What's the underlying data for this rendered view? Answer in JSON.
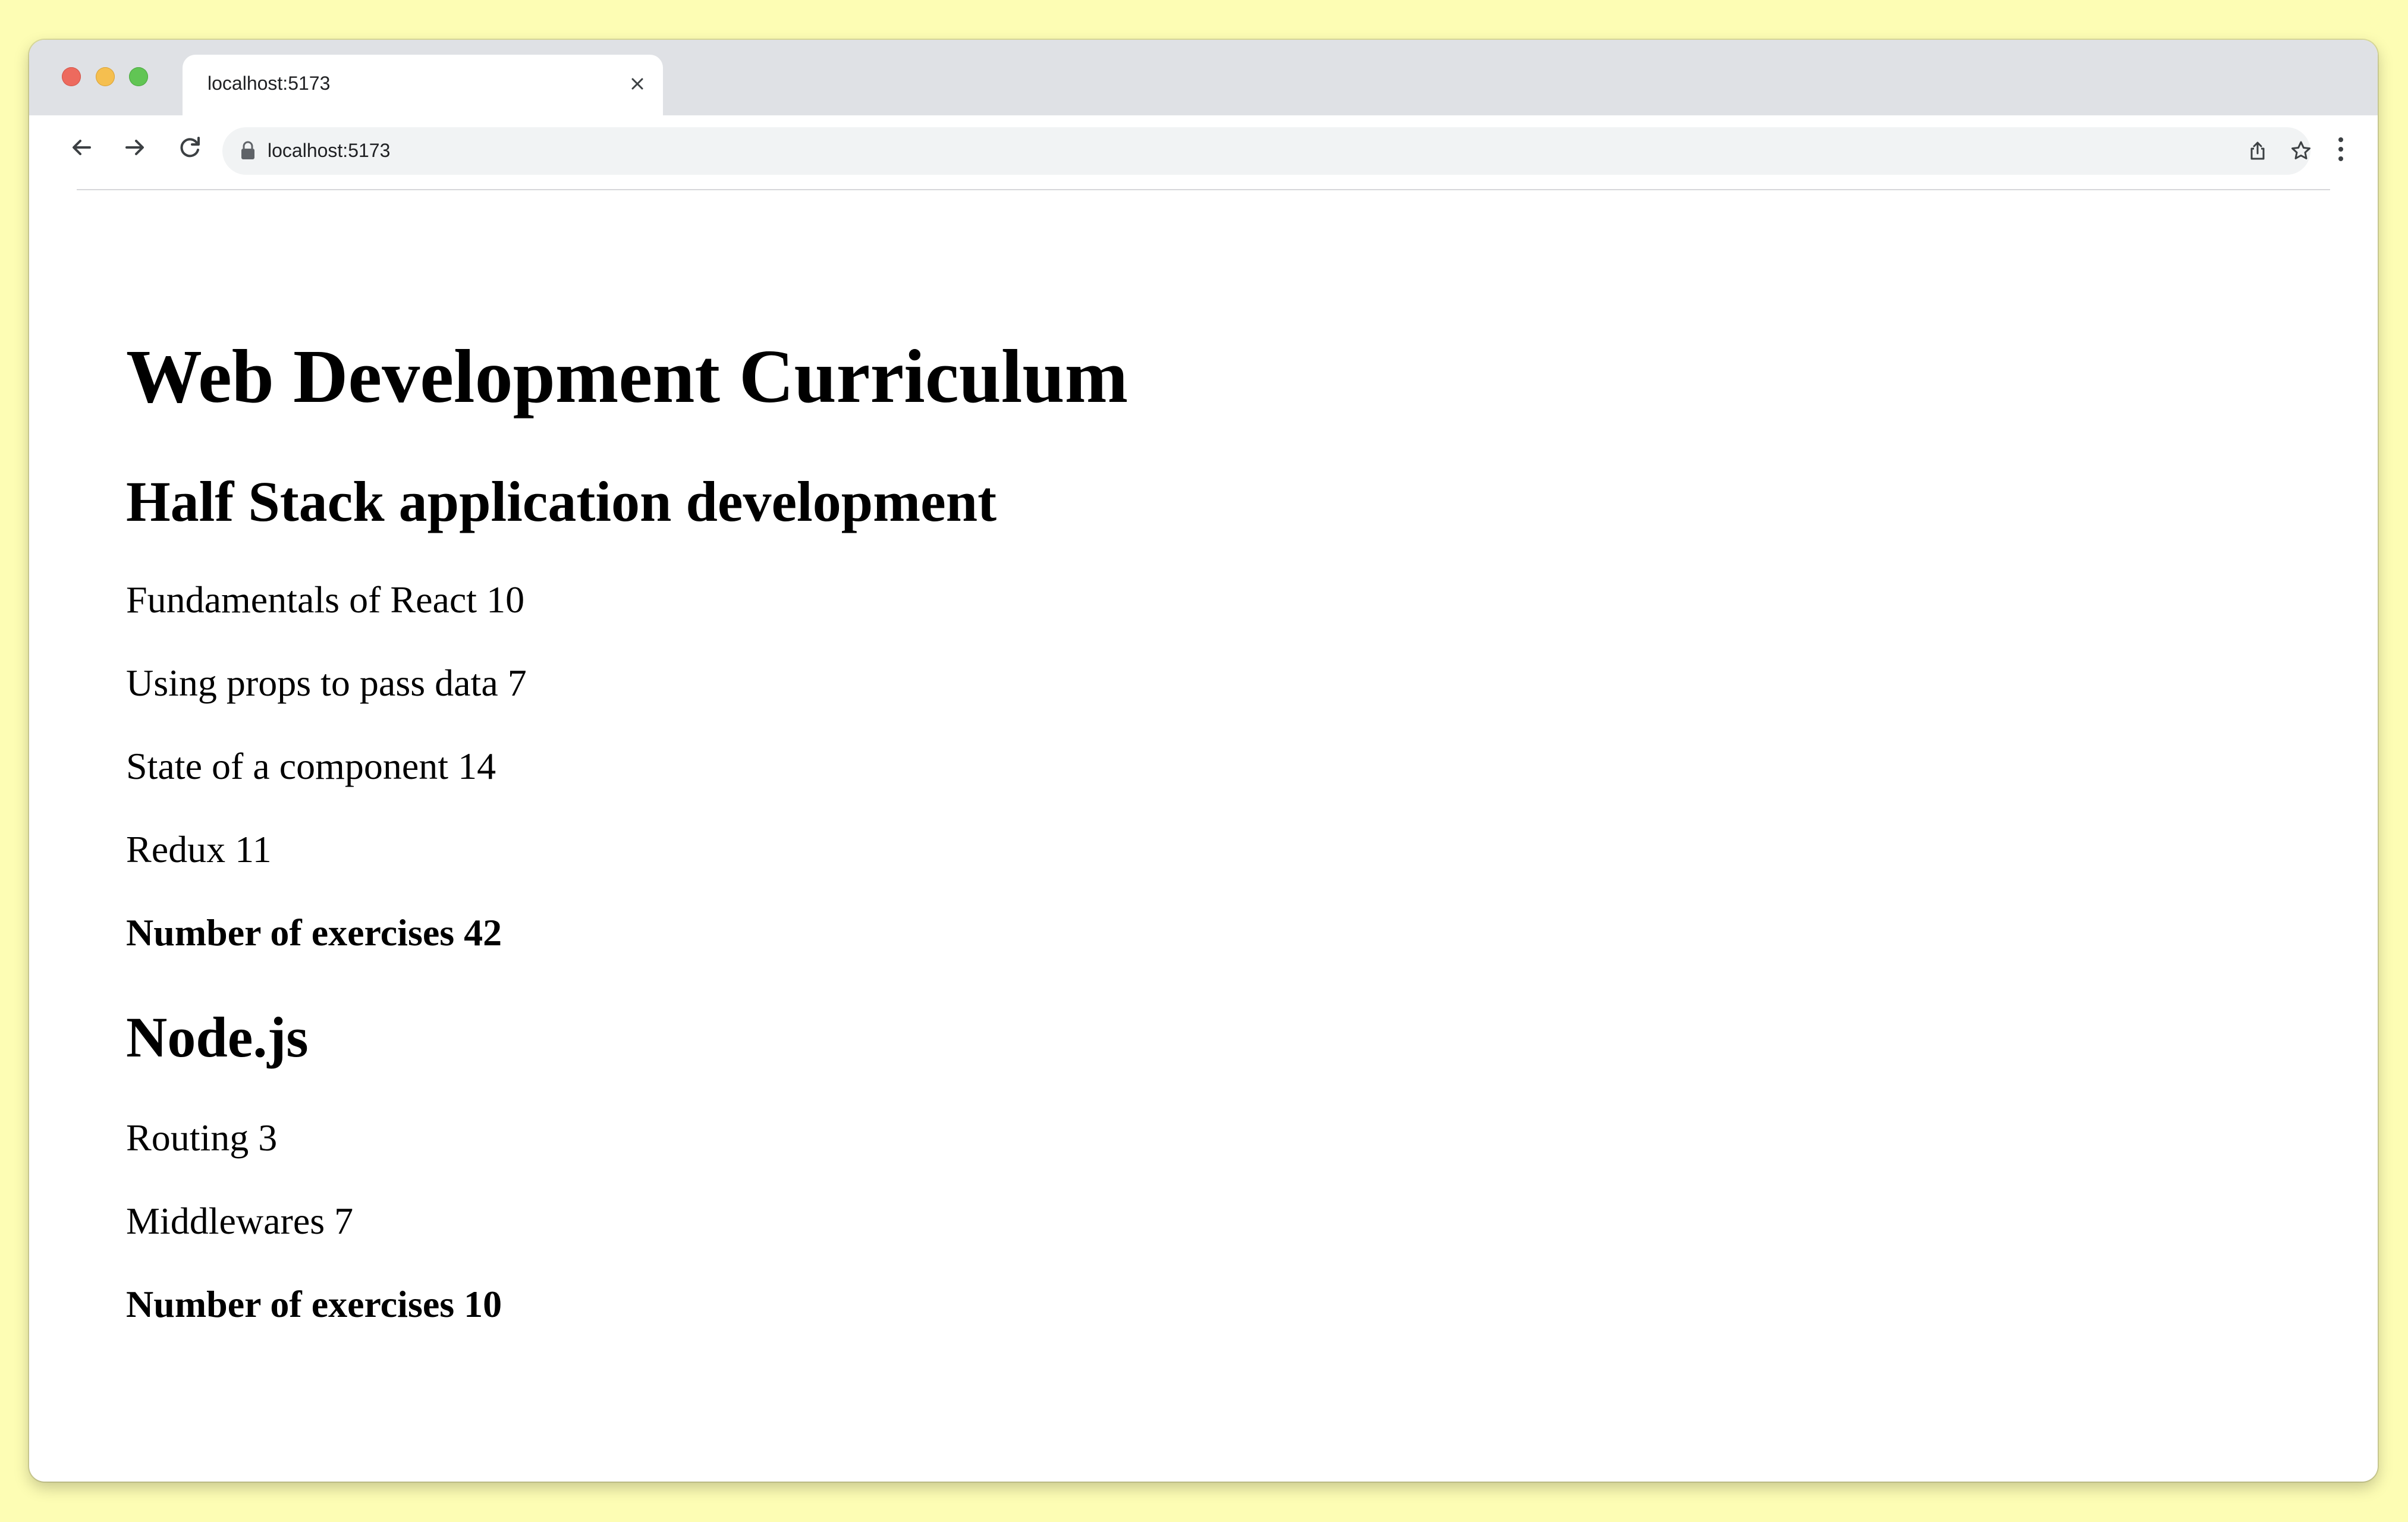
{
  "tab": {
    "title": "localhost:5173"
  },
  "address_bar": {
    "url": "localhost:5173"
  },
  "page": {
    "title": "Web Development Curriculum",
    "courses": [
      {
        "name": "Half Stack application development",
        "parts": [
          {
            "text": "Fundamentals of React 10"
          },
          {
            "text": "Using props to pass data 7"
          },
          {
            "text": "State of a component 14"
          },
          {
            "text": "Redux 11"
          }
        ],
        "total": "Number of exercises 42"
      },
      {
        "name": "Node.js",
        "parts": [
          {
            "text": "Routing 3"
          },
          {
            "text": "Middlewares 7"
          }
        ],
        "total": "Number of exercises 10"
      }
    ]
  },
  "icons": {
    "close": "close-icon",
    "back": "back-arrow-icon",
    "forward": "forward-arrow-icon",
    "reload": "reload-icon",
    "lock": "lock-icon",
    "share": "share-icon",
    "bookmark": "star-icon",
    "menu": "kebab-menu-icon"
  },
  "colors": {
    "background": "#fdfdb4",
    "tabstrip": "#dfe1e5",
    "omnibox": "#f1f3f4",
    "close_button": "#ed6a5e",
    "minimize_button": "#f5bf4f",
    "zoom_button": "#61c554"
  }
}
